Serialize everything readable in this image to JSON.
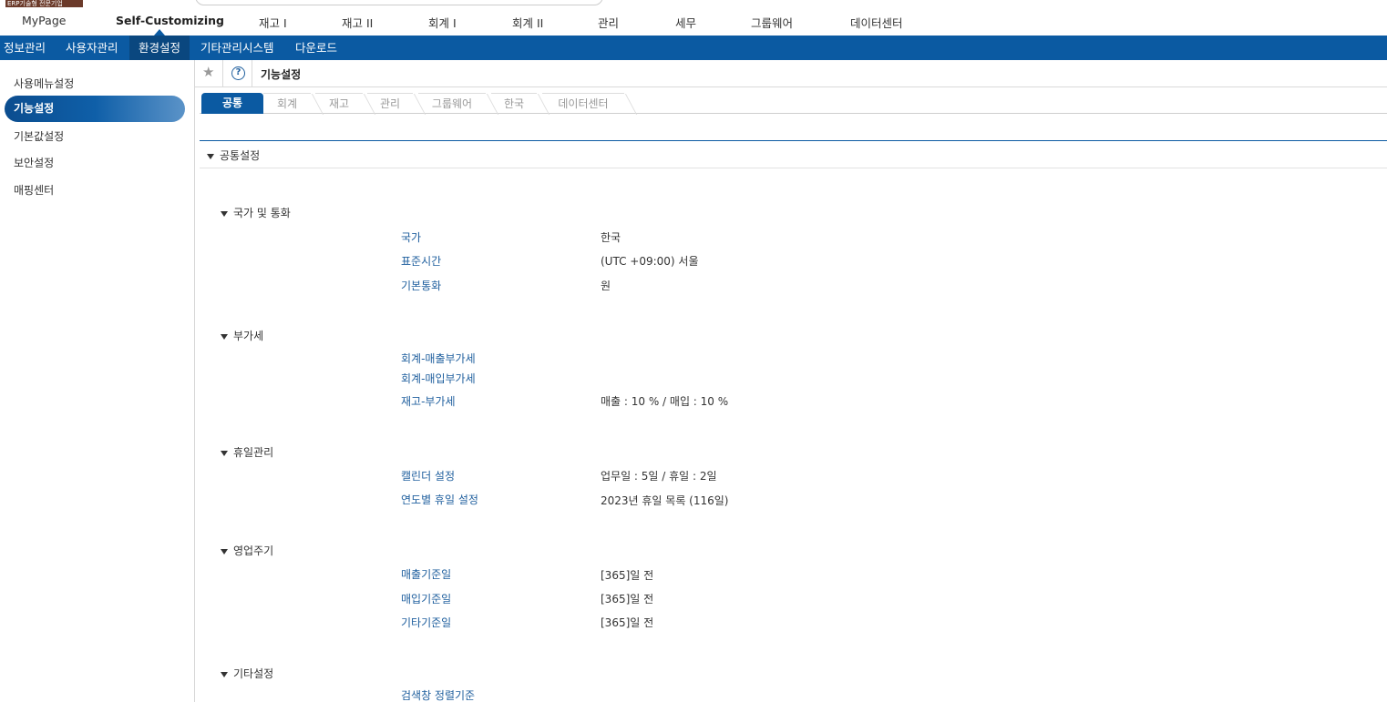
{
  "top_badge": "ERP기술형 전문기업",
  "top_nav": [
    {
      "label": "MyPage"
    },
    {
      "label": "Self-Customizing"
    },
    {
      "label": "재고 I"
    },
    {
      "label": "재고 II"
    },
    {
      "label": "회계 I"
    },
    {
      "label": "회계 II"
    },
    {
      "label": "관리"
    },
    {
      "label": "세무"
    },
    {
      "label": "그룹웨어"
    },
    {
      "label": "데이터센터"
    }
  ],
  "sub_nav": [
    {
      "label": "정보관리"
    },
    {
      "label": "사용자관리"
    },
    {
      "label": "환경설정"
    },
    {
      "label": "기타관리시스템"
    },
    {
      "label": "다운로드"
    }
  ],
  "sidebar": [
    {
      "label": "사용메뉴설정"
    },
    {
      "label": "기능설정"
    },
    {
      "label": "기본값설정"
    },
    {
      "label": "보안설정"
    },
    {
      "label": "매핑센터"
    }
  ],
  "page_title": "기능설정",
  "help_glyph": "?",
  "tabs": [
    {
      "label": "공통"
    },
    {
      "label": "회계"
    },
    {
      "label": "재고"
    },
    {
      "label": "관리"
    },
    {
      "label": "그룹웨어"
    },
    {
      "label": "한국"
    },
    {
      "label": "데이터센터"
    }
  ],
  "section_title": "공통설정",
  "groups": [
    {
      "title": "국가 및 통화",
      "rows": [
        {
          "label": "국가",
          "value": "한국"
        },
        {
          "label": "표준시간",
          "value": "(UTC +09:00) 서울"
        },
        {
          "label": "기본통화",
          "value": "원"
        }
      ]
    },
    {
      "title": "부가세",
      "rows": [
        {
          "label": "회계-매출부가세",
          "value": ""
        },
        {
          "label": "회계-매입부가세",
          "value": ""
        },
        {
          "label": "재고-부가세",
          "value": "매출 : 10 % / 매입 : 10 %"
        }
      ]
    },
    {
      "title": "휴일관리",
      "rows": [
        {
          "label": "캘린더 설정",
          "value": "업무일 : 5일 / 휴일 : 2일"
        },
        {
          "label": "연도별 휴일 설정",
          "value": "2023년 휴일 목록 (116일)"
        }
      ]
    },
    {
      "title": "영업주기",
      "rows": [
        {
          "label": "매출기준일",
          "value": "[365]일 전"
        },
        {
          "label": "매입기준일",
          "value": "[365]일 전"
        },
        {
          "label": "기타기준일",
          "value": "[365]일 전"
        }
      ]
    },
    {
      "title": "기타설정",
      "rows": [
        {
          "label": "검색창 정렬기준",
          "value": ""
        }
      ]
    }
  ]
}
